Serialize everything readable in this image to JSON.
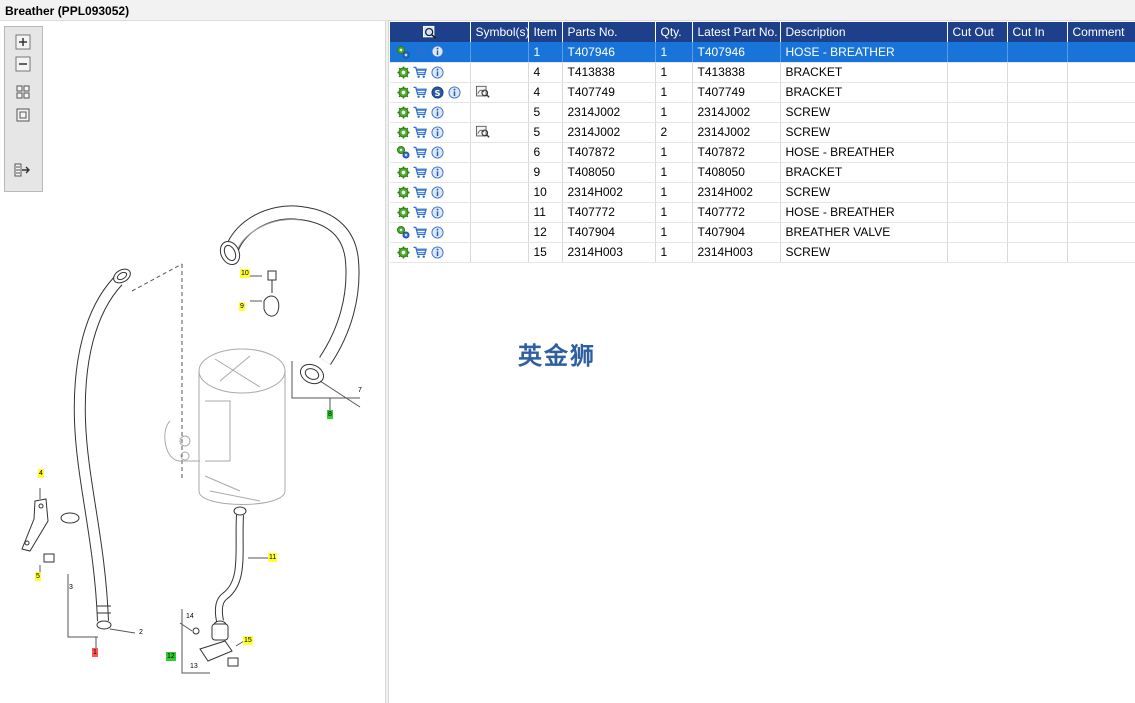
{
  "window": {
    "title": "Breather (PPL093052)"
  },
  "table": {
    "columns": [
      "",
      "Symbol(s)",
      "Item",
      "Parts No.",
      "Qty.",
      "Latest Part No.",
      "Description",
      "Cut Out",
      "Cut In",
      "Comment"
    ],
    "header_icon": "zoom-search-icon",
    "rows": [
      {
        "icons": [
          "gears-icon",
          "cart-icon",
          "info-icon"
        ],
        "symbols": [],
        "item": "1",
        "part_no": "T407946",
        "qty": "1",
        "latest": "T407946",
        "description": "HOSE - BREATHER",
        "cut_out": "",
        "cut_in": "",
        "comment": "",
        "selected": true
      },
      {
        "icons": [
          "gear-icon",
          "cart-icon",
          "info-icon"
        ],
        "symbols": [],
        "item": "4",
        "part_no": "T413838",
        "qty": "1",
        "latest": "T413838",
        "description": "BRACKET",
        "cut_out": "",
        "cut_in": "",
        "comment": ""
      },
      {
        "icons": [
          "gear-icon",
          "cart-icon",
          "s-badge-icon",
          "info-icon"
        ],
        "symbols": [
          "illustration-icon"
        ],
        "item": "4",
        "part_no": "T407749",
        "qty": "1",
        "latest": "T407749",
        "description": "BRACKET",
        "cut_out": "",
        "cut_in": "",
        "comment": ""
      },
      {
        "icons": [
          "gear-icon",
          "cart-icon",
          "info-icon"
        ],
        "symbols": [],
        "item": "5",
        "part_no": "2314J002",
        "qty": "1",
        "latest": "2314J002",
        "description": "SCREW",
        "cut_out": "",
        "cut_in": "",
        "comment": ""
      },
      {
        "icons": [
          "gear-icon",
          "cart-icon",
          "info-icon"
        ],
        "symbols": [
          "illustration-icon"
        ],
        "item": "5",
        "part_no": "2314J002",
        "qty": "2",
        "latest": "2314J002",
        "description": "SCREW",
        "cut_out": "",
        "cut_in": "",
        "comment": ""
      },
      {
        "icons": [
          "gears-icon",
          "cart-icon",
          "info-icon"
        ],
        "symbols": [],
        "item": "6",
        "part_no": "T407872",
        "qty": "1",
        "latest": "T407872",
        "description": "HOSE - BREATHER",
        "cut_out": "",
        "cut_in": "",
        "comment": ""
      },
      {
        "icons": [
          "gear-icon",
          "cart-icon",
          "info-icon"
        ],
        "symbols": [],
        "item": "9",
        "part_no": "T408050",
        "qty": "1",
        "latest": "T408050",
        "description": "BRACKET",
        "cut_out": "",
        "cut_in": "",
        "comment": ""
      },
      {
        "icons": [
          "gear-icon",
          "cart-icon",
          "info-icon"
        ],
        "symbols": [],
        "item": "10",
        "part_no": "2314H002",
        "qty": "1",
        "latest": "2314H002",
        "description": "SCREW",
        "cut_out": "",
        "cut_in": "",
        "comment": ""
      },
      {
        "icons": [
          "gear-icon",
          "cart-icon",
          "info-icon"
        ],
        "symbols": [],
        "item": "11",
        "part_no": "T407772",
        "qty": "1",
        "latest": "T407772",
        "description": "HOSE - BREATHER",
        "cut_out": "",
        "cut_in": "",
        "comment": ""
      },
      {
        "icons": [
          "gears-icon",
          "cart-icon",
          "info-icon"
        ],
        "symbols": [],
        "item": "12",
        "part_no": "T407904",
        "qty": "1",
        "latest": "T407904",
        "description": "BREATHER VALVE",
        "cut_out": "",
        "cut_in": "",
        "comment": ""
      },
      {
        "icons": [
          "gear-icon",
          "cart-icon",
          "info-icon"
        ],
        "symbols": [],
        "item": "15",
        "part_no": "2314H003",
        "qty": "1",
        "latest": "2314H003",
        "description": "SCREW",
        "cut_out": "",
        "cut_in": "",
        "comment": ""
      }
    ]
  },
  "toolbar": {
    "buttons": [
      "zoom-in-icon",
      "zoom-out-icon",
      "fit-all-icon",
      "fit-window-icon",
      "export-icon"
    ]
  },
  "diagram": {
    "callouts": [
      {
        "text": "10",
        "style": "y"
      },
      {
        "text": "9",
        "style": "y"
      },
      {
        "text": "7",
        "style": "p"
      },
      {
        "text": "8",
        "style": "g"
      },
      {
        "text": "4",
        "style": "y"
      },
      {
        "text": "5",
        "style": "y"
      },
      {
        "text": "3",
        "style": "p"
      },
      {
        "text": "2",
        "style": "p"
      },
      {
        "text": "1",
        "style": "r"
      },
      {
        "text": "11",
        "style": "y"
      },
      {
        "text": "14",
        "style": "p"
      },
      {
        "text": "15",
        "style": "y"
      },
      {
        "text": "12",
        "style": "g"
      },
      {
        "text": "13",
        "style": "p"
      }
    ]
  },
  "watermark": {
    "text": "英金狮"
  },
  "colors": {
    "header_bg": "#1e3f8a",
    "selection_bg": "#1874d9",
    "callout_yellow": "#ffff33",
    "callout_green": "#33cc33",
    "callout_red": "#ff5555",
    "watermark": "#2e5f9e"
  }
}
